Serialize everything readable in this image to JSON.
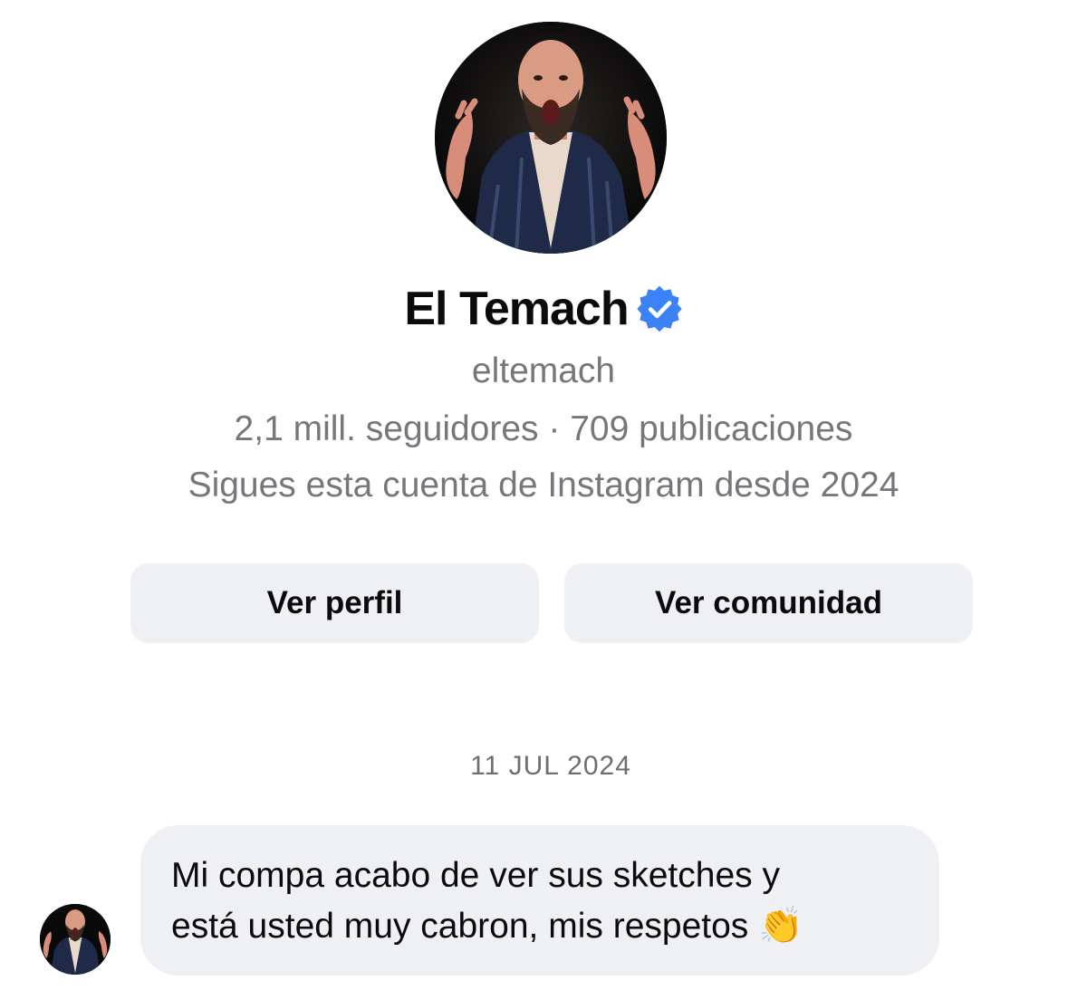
{
  "profile": {
    "name": "El Temach",
    "verified_icon": "verified-badge-icon",
    "username": "eltemach",
    "stats": "2,1 mill. seguidores · 709 publicaciones",
    "follow_since": "Sigues esta cuenta de Instagram desde 2024",
    "avatar_icon": "profile-photo"
  },
  "actions": {
    "view_profile": "Ver perfil",
    "view_community": "Ver comunidad"
  },
  "chat": {
    "date": "11 JUL 2024",
    "messages": [
      {
        "text": "Mi compa acabo de ver sus sketches y\nestá usted muy cabron, mis respetos",
        "emoji": "👏"
      }
    ]
  },
  "colors": {
    "verified": "#3b82f6",
    "button_bg": "#eff0f4",
    "bubble_bg": "#eff0f4",
    "secondary_text": "#76767b"
  }
}
